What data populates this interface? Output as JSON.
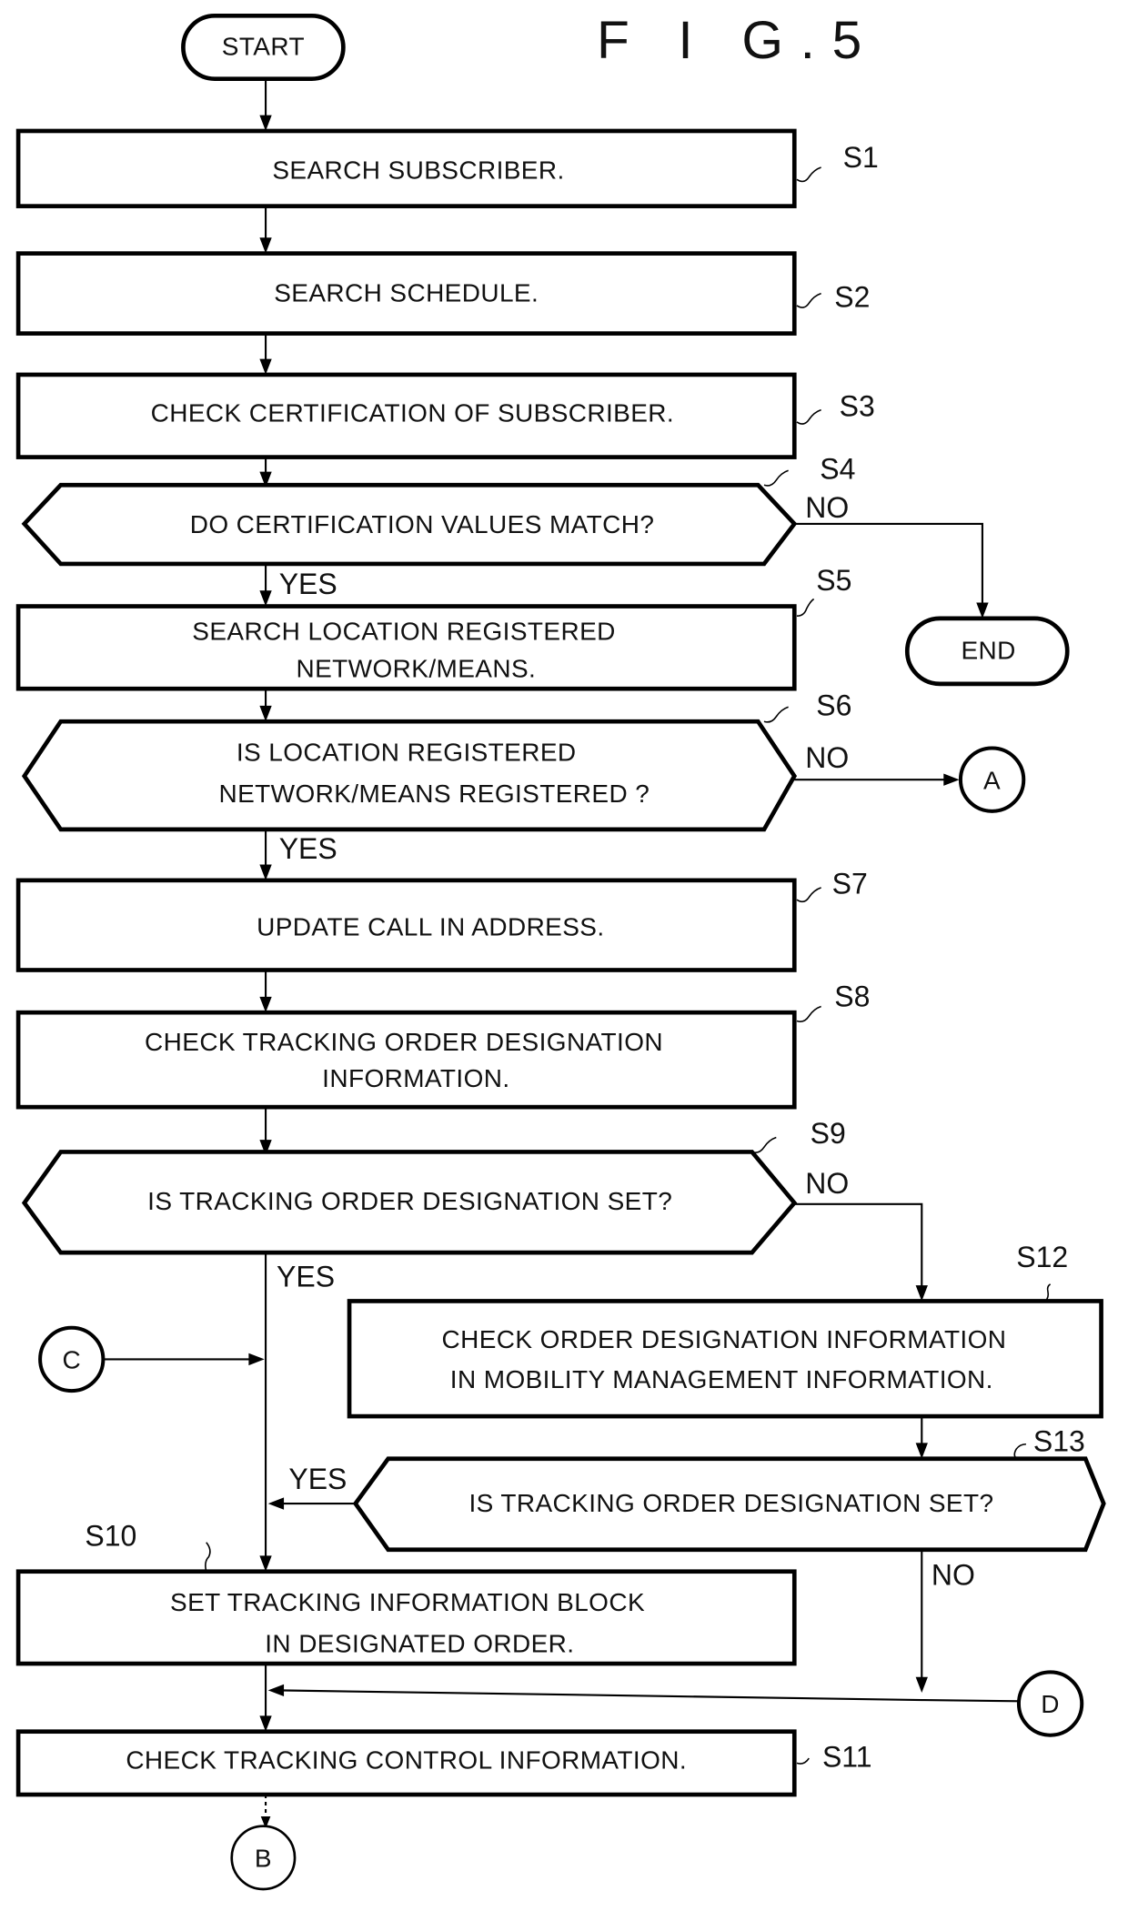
{
  "figure_title": "F I G.5",
  "terminals": {
    "start": "START",
    "end": "END"
  },
  "steps": {
    "s1": {
      "id": "S1",
      "lines": [
        "SEARCH SUBSCRIBER."
      ]
    },
    "s2": {
      "id": "S2",
      "lines": [
        "SEARCH SCHEDULE."
      ]
    },
    "s3": {
      "id": "S3",
      "lines": [
        "CHECK CERTIFICATION OF SUBSCRIBER."
      ]
    },
    "s4": {
      "id": "S4",
      "lines": [
        "DO CERTIFICATION VALUES MATCH?"
      ]
    },
    "s5": {
      "id": "S5",
      "lines": [
        "SEARCH LOCATION REGISTERED",
        "NETWORK/MEANS."
      ]
    },
    "s6": {
      "id": "S6",
      "lines": [
        "IS LOCATION REGISTERED",
        "NETWORK/MEANS REGISTERED ?"
      ]
    },
    "s7": {
      "id": "S7",
      "lines": [
        "UPDATE CALL IN ADDRESS."
      ]
    },
    "s8": {
      "id": "S8",
      "lines": [
        "CHECK TRACKING ORDER DESIGNATION",
        "INFORMATION."
      ]
    },
    "s9": {
      "id": "S9",
      "lines": [
        "IS TRACKING ORDER DESIGNATION SET?"
      ]
    },
    "s10": {
      "id": "S10",
      "lines": [
        "SET TRACKING INFORMATION BLOCK",
        "IN DESIGNATED ORDER."
      ]
    },
    "s11": {
      "id": "S11",
      "lines": [
        "CHECK TRACKING CONTROL INFORMATION."
      ]
    },
    "s12": {
      "id": "S12",
      "lines": [
        "CHECK ORDER DESIGNATION INFORMATION",
        "IN MOBILITY MANAGEMENT   INFORMATION."
      ]
    },
    "s13": {
      "id": "S13",
      "lines": [
        "IS TRACKING ORDER DESIGNATION SET?"
      ]
    }
  },
  "branch_labels": {
    "yes": "YES",
    "no": "NO"
  },
  "connectors": {
    "a": "A",
    "b": "B",
    "c": "C",
    "d": "D"
  }
}
